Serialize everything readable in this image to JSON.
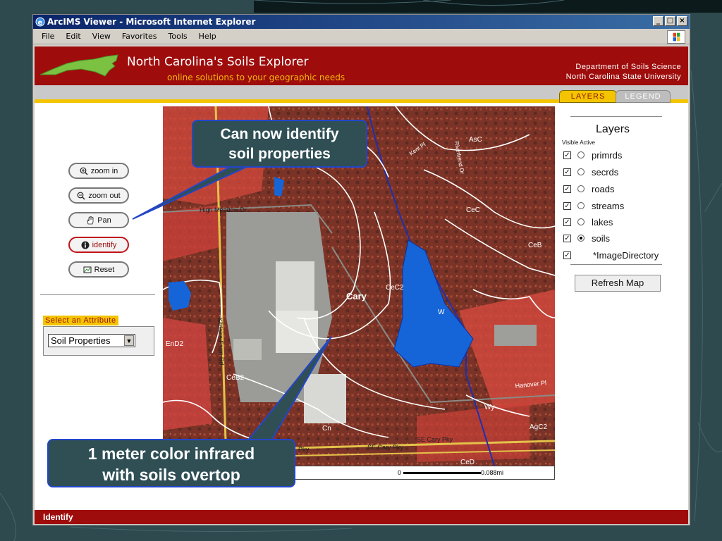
{
  "window": {
    "title": "ArcIMS Viewer - Microsoft Internet Explorer",
    "controls": [
      "_",
      "□",
      "×"
    ]
  },
  "menu": [
    "File",
    "Edit",
    "View",
    "Favorites",
    "Tools",
    "Help"
  ],
  "header": {
    "title": "North Carolina's Soils Explorer",
    "subtitle": "online solutions to your geographic needs",
    "dept_line1": "Department of Soils Science",
    "dept_line2": "North Carolina State University"
  },
  "tabs": {
    "layers": "LAYERS",
    "legend": "LEGEND"
  },
  "tools": {
    "zoom_in": "zoom in",
    "zoom_out": "zoom out",
    "pan": "Pan",
    "identify": "identify",
    "reset": "Reset"
  },
  "attribute": {
    "label": "Select an Attribute",
    "selected": "Soil Properties"
  },
  "layers_panel": {
    "title": "Layers",
    "visible_active_label": "Visible Active",
    "layers": [
      {
        "name": "primrds",
        "visible": true,
        "active": false
      },
      {
        "name": "secrds",
        "visible": true,
        "active": false
      },
      {
        "name": "roads",
        "visible": true,
        "active": false
      },
      {
        "name": "streams",
        "visible": true,
        "active": false
      },
      {
        "name": "lakes",
        "visible": true,
        "active": false
      },
      {
        "name": "soils",
        "visible": true,
        "active": true
      },
      {
        "name": "*ImageDirectory",
        "visible": true,
        "active": null
      }
    ],
    "refresh_label": "Refresh Map"
  },
  "map_labels": {
    "cary": "Cary",
    "high_meadow": "High Meadow Dr",
    "kildaire": "Kildaire Farm Rd",
    "hanover": "Hanover Pl",
    "se_cary": "SE Cary Pky",
    "se_cary2": "SE Cary Pky",
    "pky": "Pky",
    "asc": "AsC",
    "cec": "CeC",
    "ceb": "CeB",
    "cec2": "CeC2",
    "w": "W",
    "end2": "EnD2",
    "ceb2": "CeB2",
    "cn": "Cn",
    "ced": "CeD",
    "wy": "Wy",
    "agc2": "AgC2",
    "kent": "Kent Pl",
    "rd": "Riverbend Dr"
  },
  "scale": {
    "left": "0",
    "right": "0.088mi"
  },
  "status": "Identify",
  "callouts": {
    "c1_line1": "Can now identify",
    "c1_line2": "soil properties",
    "c2_line1": "1 meter color infrared",
    "c2_line2": "with soils overtop"
  },
  "colors": {
    "brand": "#9e0c0c",
    "accent": "#f4c400",
    "lake": "#1565d8",
    "callout_border": "#2346c9"
  }
}
